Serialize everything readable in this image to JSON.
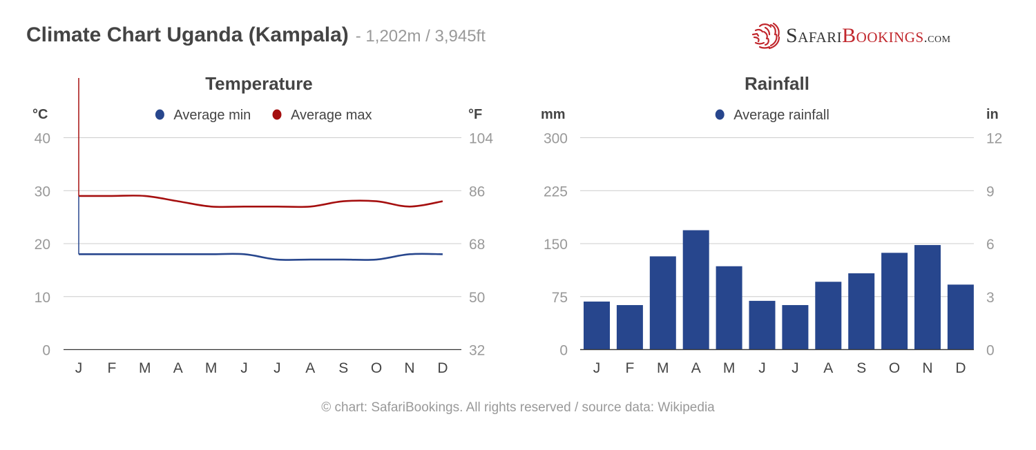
{
  "header": {
    "title": "Climate Chart Uganda (Kampala)",
    "subtitle": "- 1,202m / 3,945ft"
  },
  "logo": {
    "icon": "lion-head-icon",
    "part1": "Safari",
    "part2": "Bookings",
    "part3": ".com",
    "colors": {
      "dark": "#333333",
      "red": "#c1272d"
    }
  },
  "footer": {
    "text": "© chart: SafariBookings. All rights reserved / source data: Wikipedia"
  },
  "chart_data": [
    {
      "type": "line",
      "title": "Temperature",
      "categories": [
        "J",
        "F",
        "M",
        "A",
        "M",
        "J",
        "J",
        "A",
        "S",
        "O",
        "N",
        "D"
      ],
      "series": [
        {
          "name": "Average min",
          "color": "#27468d",
          "values": [
            18,
            18,
            18,
            18,
            18,
            18,
            17,
            17,
            17,
            17,
            18,
            18
          ]
        },
        {
          "name": "Average max",
          "color": "#a50f0f",
          "values": [
            29,
            29,
            29,
            28,
            27,
            27,
            27,
            27,
            28,
            28,
            27,
            28
          ]
        }
      ],
      "ylabel_left": "°C",
      "ylabel_right": "°F",
      "ylim": [
        0,
        40
      ],
      "yticks_left": [
        "0",
        "10",
        "20",
        "30",
        "40"
      ],
      "yticks_right": [
        "32",
        "50",
        "68",
        "86",
        "104"
      ],
      "grid": true,
      "legend": "top-center"
    },
    {
      "type": "bar",
      "title": "Rainfall",
      "categories": [
        "J",
        "F",
        "M",
        "A",
        "M",
        "J",
        "J",
        "A",
        "S",
        "O",
        "N",
        "D"
      ],
      "series": [
        {
          "name": "Average rainfall",
          "color": "#27468d",
          "values": [
            68,
            63,
            132,
            169,
            118,
            69,
            63,
            96,
            108,
            137,
            148,
            92
          ]
        }
      ],
      "ylabel_left": "mm",
      "ylabel_right": "in",
      "ylim": [
        0,
        300
      ],
      "yticks_left": [
        "0",
        "75",
        "150",
        "225",
        "300"
      ],
      "yticks_right": [
        "0",
        "3",
        "6",
        "9",
        "12"
      ],
      "grid": true,
      "legend": "top-center"
    }
  ]
}
